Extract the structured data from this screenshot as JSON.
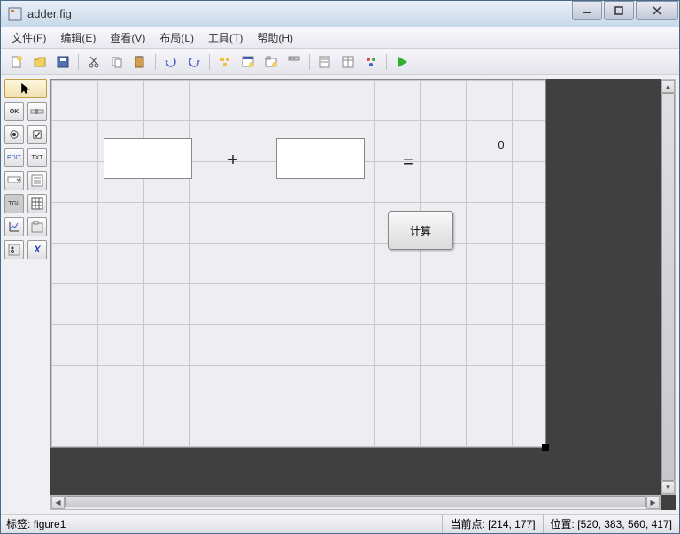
{
  "title": "adder.fig",
  "menus": {
    "file": "文件(F)",
    "edit": "编辑(E)",
    "view": "查看(V)",
    "layout": "布局(L)",
    "tools": "工具(T)",
    "help": "帮助(H)"
  },
  "toolbar": {
    "new": "new",
    "open": "open",
    "save": "save",
    "cut": "cut",
    "copy": "copy",
    "paste": "paste",
    "undo": "undo",
    "redo": "redo",
    "align": "align",
    "menu_editor": "menu_editor",
    "tab_editor": "tab_editor",
    "toolbar_editor": "toolbar_editor",
    "editor": "editor",
    "property": "property",
    "object": "object",
    "run": "run"
  },
  "palette": {
    "select": "select",
    "push": "OK",
    "slider": "slider",
    "radio": "radio",
    "check": "check",
    "edit": "EDIT",
    "text": "TXT",
    "popup": "popup",
    "list": "list",
    "toggle": "TGL",
    "table": "table",
    "axes": "axes",
    "panel": "panel",
    "buttongroup": "bg",
    "activex": "X"
  },
  "figure": {
    "plus": "+",
    "equals": "=",
    "result": "0",
    "compute_btn": "计算"
  },
  "status": {
    "tag_label": "标签:",
    "tag_value": "figure1",
    "curpt_label": "当前点:",
    "curpt_value": "[214, 177]",
    "pos_label": "位置:",
    "pos_value": "[520, 383, 560, 417]"
  }
}
